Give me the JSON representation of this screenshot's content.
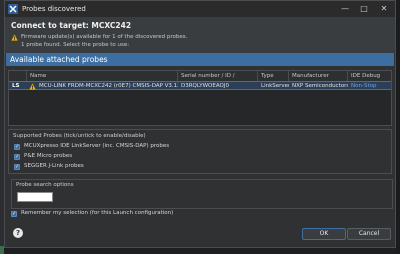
{
  "window": {
    "title": "Probes discovered",
    "minimize_glyph": "—",
    "maximize_glyph": "□",
    "close_glyph": "✕"
  },
  "header": {
    "title": "Connect to target: MCXC242",
    "warning": "Firmware update(s) available for 1 of the discovered probes.",
    "subtitle": "1 probe found. Select the probe to use:"
  },
  "probes_section": {
    "title": "Available attached probes",
    "columns": [
      "Name",
      "Serial number / ID / Nickname",
      "Type",
      "Manufacturer",
      "IDE Debug Mode"
    ],
    "rows": [
      {
        "marker": "LS",
        "name": "MCU-LINK FRDM-MCXC242 (r0E7) CMSIS-DAP V3.128",
        "serial": "D3RQLYWOEAOJ0",
        "type": "LinkServer",
        "manufacturer": "NXP Semiconductors",
        "mode": "Non-Stop"
      }
    ]
  },
  "supported": {
    "title": "Supported Probes (tick/untick to enable/disable)",
    "items": [
      {
        "label": "MCUXpresso IDE LinkServer (inc. CMSIS-DAP) probes",
        "checked": true
      },
      {
        "label": "P&E Micro probes",
        "checked": true
      },
      {
        "label": "SEGGER J-Link probes",
        "checked": true
      }
    ]
  },
  "search": {
    "title": "Probe search options",
    "value": ""
  },
  "remember": {
    "label": "Remember my selection (for this Launch configuration)",
    "checked": true
  },
  "buttons": {
    "help": "?",
    "ok": "OK",
    "cancel": "Cancel"
  },
  "colors": {
    "accent": "#3d6ea1",
    "warning": "#f0b400",
    "mode_text": "#6aa6e8"
  }
}
